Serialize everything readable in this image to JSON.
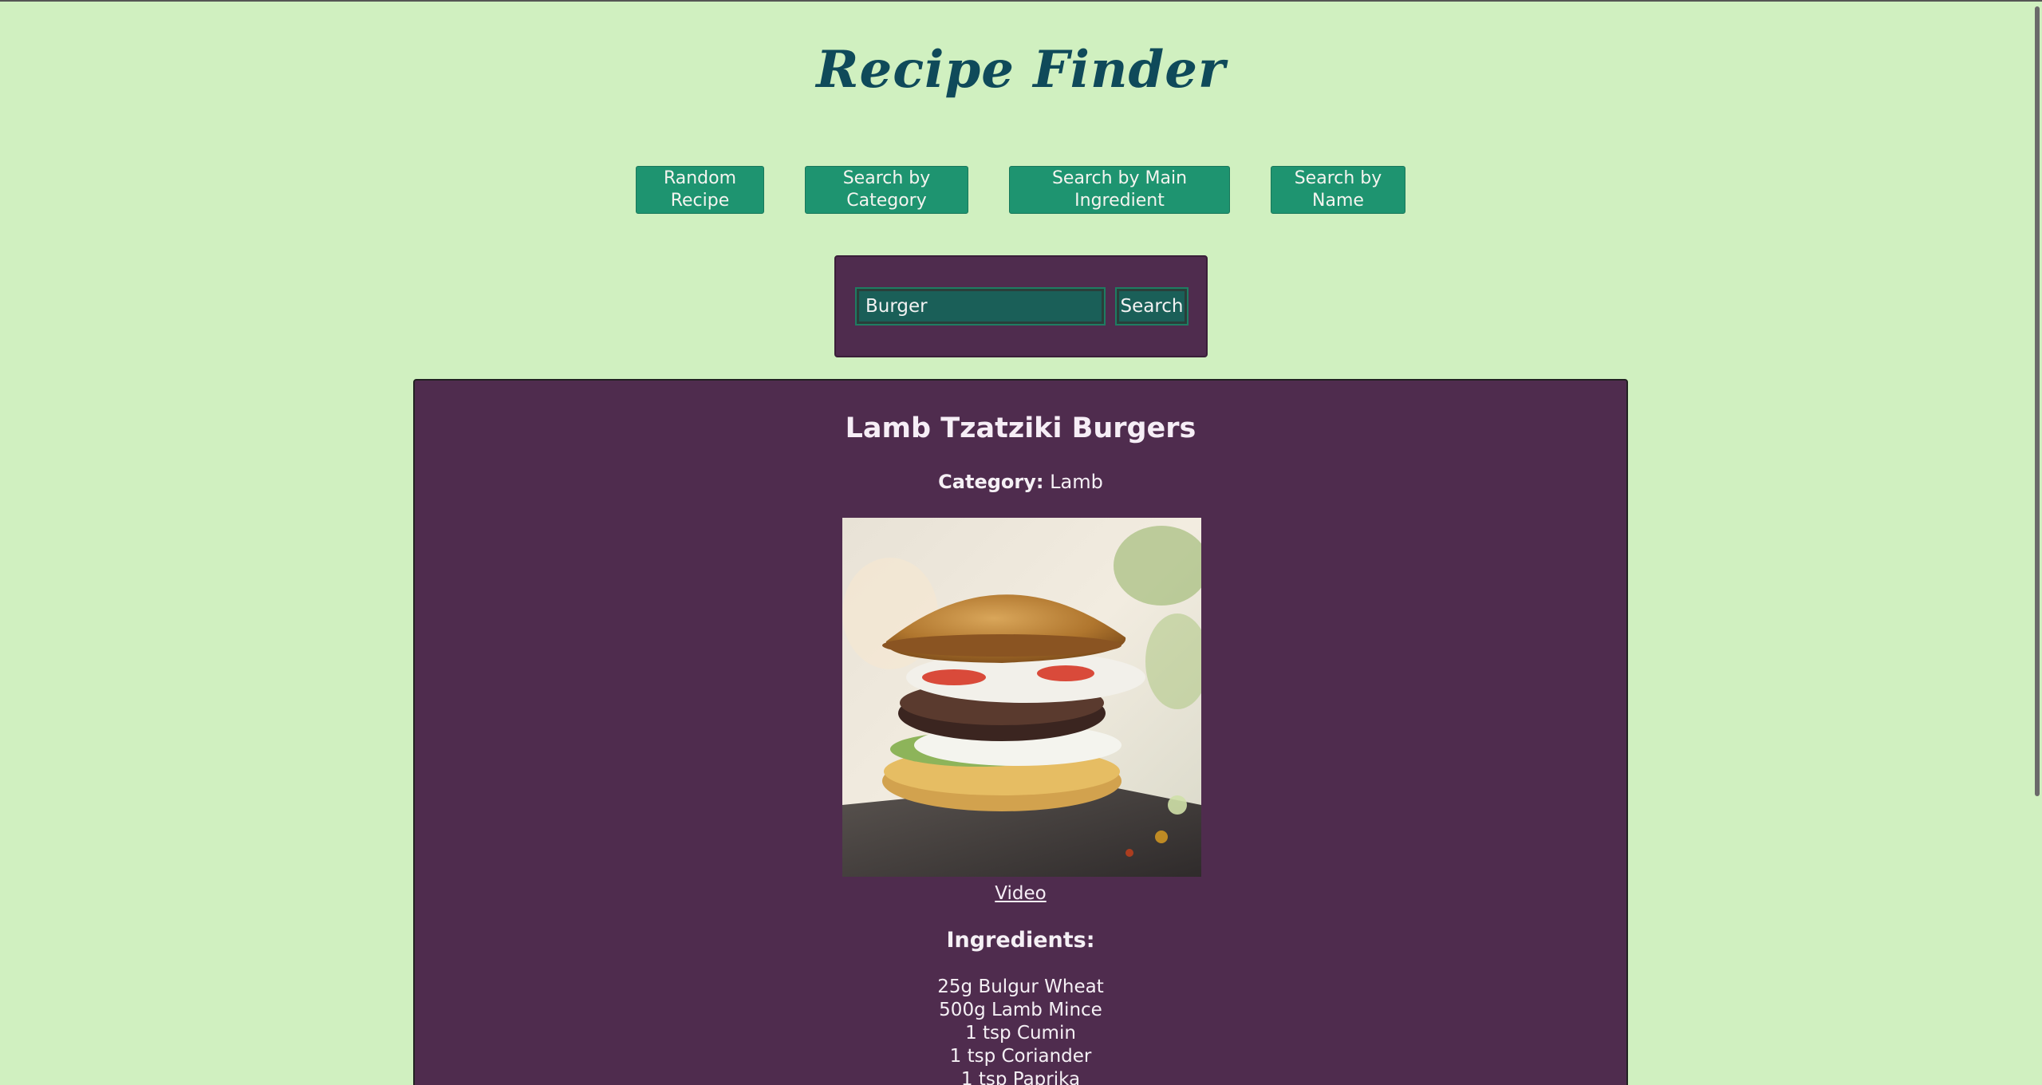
{
  "app": {
    "title": "Recipe Finder"
  },
  "nav": {
    "buttons": [
      {
        "label": "Random Recipe"
      },
      {
        "label": "Search by Category"
      },
      {
        "label": "Search by Main Ingredient"
      },
      {
        "label": "Search by Name"
      }
    ]
  },
  "search": {
    "value": "Burger",
    "button_label": "Search"
  },
  "recipe": {
    "name": "Lamb Tzatziki Burgers",
    "category_label": "Category:",
    "category_value": "Lamb",
    "video_label": "Video",
    "ingredients_heading": "Ingredients:",
    "ingredients": [
      "25g Bulgur Wheat",
      "500g Lamb Mince",
      "1 tsp Cumin",
      "1 tsp Coriander",
      "1 tsp Paprika"
    ]
  },
  "colors": {
    "background": "#d0f0c0",
    "title": "#0f4a5a",
    "button": "#1e9470",
    "panel": "#4f2c4e"
  }
}
